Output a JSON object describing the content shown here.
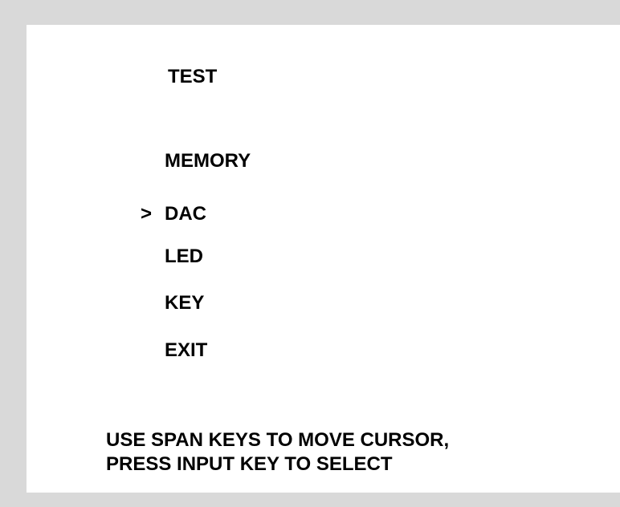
{
  "screen": {
    "title": "TEST",
    "menu": [
      {
        "label": "MEMORY",
        "selected": false
      },
      {
        "label": "DAC",
        "selected": true
      },
      {
        "label": "LED",
        "selected": false
      },
      {
        "label": "KEY",
        "selected": false
      },
      {
        "label": "EXIT",
        "selected": false
      }
    ],
    "cursor_glyph": ">",
    "instructions": {
      "line1": "USE SPAN KEYS TO MOVE CURSOR,",
      "line2": "PRESS INPUT KEY TO SELECT"
    }
  },
  "colors": {
    "frame": "#d9d9d9",
    "screen_bg": "#ffffff",
    "text": "#000000"
  }
}
